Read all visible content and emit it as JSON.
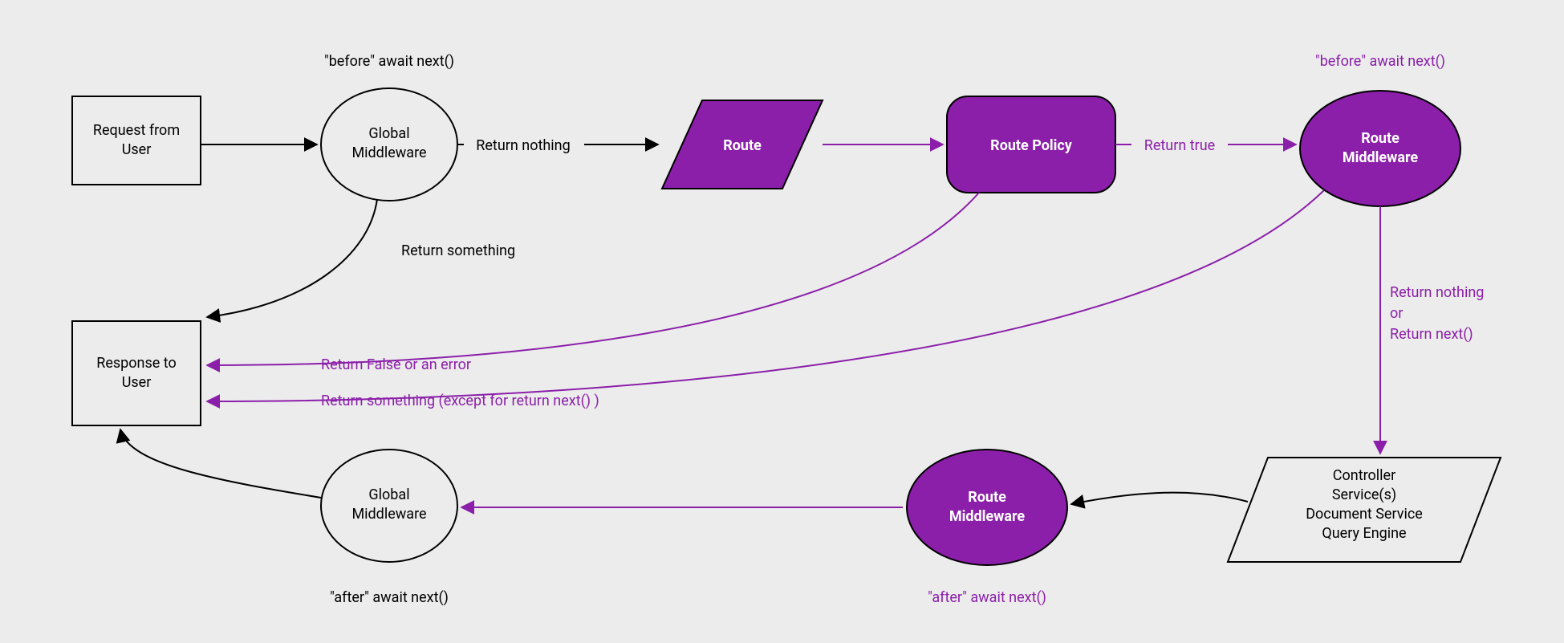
{
  "colors": {
    "purple": "#8b1fa9",
    "black": "#000000",
    "bg": "#ececec"
  },
  "nodes": {
    "request": {
      "label": "Request from\nUser"
    },
    "response": {
      "label": "Response to\nUser"
    },
    "globalMwBefore": {
      "label": "Global\nMiddleware",
      "caption": "\"before\" await next()"
    },
    "globalMwAfter": {
      "label": "Global\nMiddleware",
      "caption": "\"after\" await next()"
    },
    "route": {
      "label": "Route"
    },
    "routePolicy": {
      "label": "Route Policy"
    },
    "routeMwBefore": {
      "label": "Route\nMiddleware",
      "caption": "\"before\" await next()"
    },
    "routeMwAfter": {
      "label": "Route\nMiddleware",
      "caption": "\"after\" await next()"
    },
    "controller": {
      "label": "Controller\nService(s)\nDocument Service\nQuery Engine"
    }
  },
  "edges": {
    "requestToGlobal": {
      "label": ""
    },
    "globalToRoute": {
      "label": "Return nothing"
    },
    "globalToResponse": {
      "label": "Return something"
    },
    "routeToPolicy": {
      "label": ""
    },
    "policyToRouteMw": {
      "label": "Return true"
    },
    "policyToResponseFalse": {
      "label": "Return False or an error"
    },
    "routeMwToController": {
      "label": "Return nothing\nor\nReturn next()"
    },
    "routeMwToResponse": {
      "label": "Return something (except for return next() )"
    },
    "controllerToRouteMwAfter": {
      "label": ""
    },
    "routeMwAfterToGlobalAfter": {
      "label": ""
    },
    "globalAfterToResponse": {
      "label": ""
    }
  }
}
